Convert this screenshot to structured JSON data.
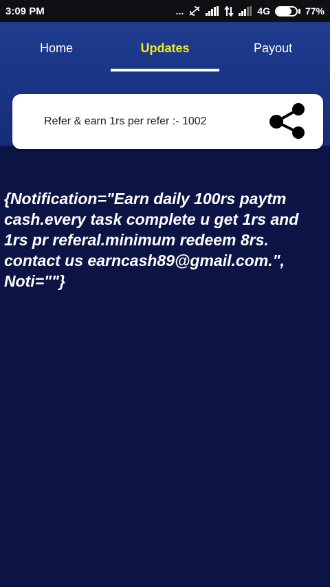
{
  "status_bar": {
    "time": "3:09 PM",
    "dots": "...",
    "network": "4G",
    "battery": "77%",
    "battery_level": 0.77,
    "icons": [
      "sync-off-icon",
      "signal-icon",
      "data-arrows-icon",
      "signal-weak-icon",
      "battery-icon"
    ]
  },
  "tabs": [
    {
      "label": "Home",
      "active": false
    },
    {
      "label": "Updates",
      "active": true
    },
    {
      "label": "Payout",
      "active": false
    }
  ],
  "refer_card": {
    "text": "Refer & earn 1rs per refer :- 1002",
    "icon": "share-icon"
  },
  "notification": {
    "text": "{Notification=\"Earn daily 100rs paytm cash.every task complete u get 1rs and 1rs pr referal.minimum redeem 8rs. contact us earncash89@gmail.com.\", Noti=\"\"}"
  },
  "colors": {
    "background": "#0b1444",
    "header": "#1a3383",
    "active_tab": "#f3ea1c",
    "card": "#ffffff"
  }
}
